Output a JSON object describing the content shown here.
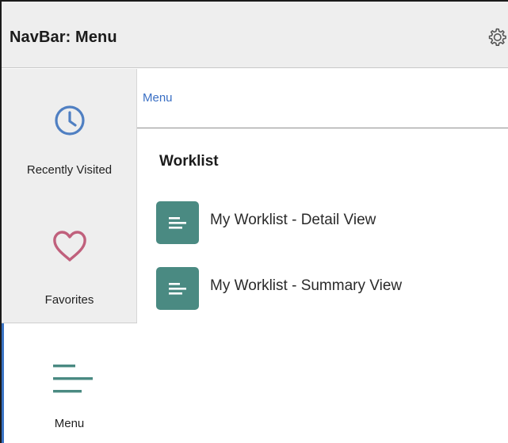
{
  "header": {
    "title": "NavBar: Menu",
    "settings_icon": "gear-icon"
  },
  "sidebar": {
    "items": [
      {
        "label": "Recently Visited",
        "icon": "clock-icon",
        "icon_color": "#4f7fc2"
      },
      {
        "label": "Favorites",
        "icon": "heart-icon",
        "icon_color": "#c0607c"
      },
      {
        "label": "Menu",
        "icon": "menu-lines-icon",
        "icon_color": "#4a8a82",
        "active": true
      }
    ],
    "active_accent": "#3a74c4"
  },
  "main": {
    "breadcrumb": "Menu",
    "section_title": "Worklist",
    "items": [
      {
        "label": "My Worklist - Detail View",
        "icon": "document-lines-icon"
      },
      {
        "label": "My Worklist - Summary View",
        "icon": "document-lines-icon"
      }
    ],
    "tile_color": "#4a8a82"
  }
}
